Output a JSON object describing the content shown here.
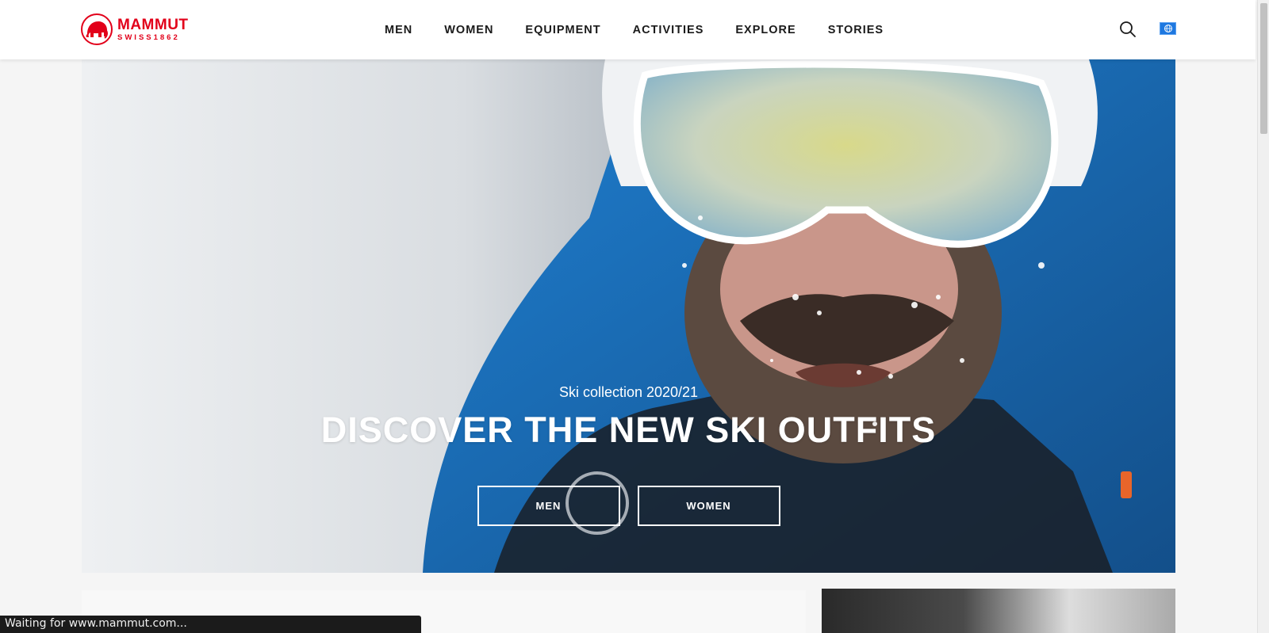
{
  "header": {
    "logo": {
      "word": "MAMMUT",
      "sub": "SWISS1862",
      "icon": "mammoth-logo-icon",
      "brand_color": "#e2001a"
    },
    "nav": [
      {
        "label": "MEN"
      },
      {
        "label": "WOMEN"
      },
      {
        "label": "EQUIPMENT"
      },
      {
        "label": "ACTIVITIES"
      },
      {
        "label": "EXPLORE"
      },
      {
        "label": "STORIES"
      }
    ],
    "search_icon": "search-icon",
    "flag_icon": "globe-flag-icon"
  },
  "hero": {
    "subtitle": "Ski collection 2020/21",
    "title": "DISCOVER THE NEW SKI OUTFITS",
    "buttons": [
      {
        "label": "MEN"
      },
      {
        "label": "WOMEN"
      }
    ]
  },
  "status_bar": {
    "text": "Waiting for www.mammut.com..."
  }
}
